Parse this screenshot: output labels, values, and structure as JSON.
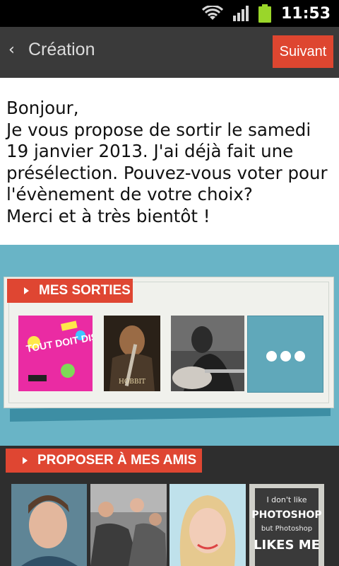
{
  "status_bar": {
    "time": "11:53",
    "icons": [
      "wifi-icon",
      "signal-icon",
      "battery-icon"
    ]
  },
  "action_bar": {
    "back_icon": "‹",
    "title": "Création",
    "next_label": "Suivant"
  },
  "message": {
    "lines": [
      "Bonjour,",
      "Je vous propose de sortir le samedi",
      "19 janvier 2013. J'ai déjà fait une",
      "présélection. Pouvez-vous voter pour",
      "l'évènement de votre choix?",
      "Merci et à très bientôt !"
    ]
  },
  "sorties": {
    "label": "MES SORTIES",
    "items": [
      {
        "name": "event-thumbnail-tout-doit-disparaitre",
        "caption": "TOUT DOIT DISPARAITRE"
      },
      {
        "name": "event-thumbnail-hobbit-poster",
        "caption": "HOBBIT"
      },
      {
        "name": "event-thumbnail-guitarist-photo",
        "caption": ""
      }
    ],
    "more_icon": "more-dots-icon"
  },
  "amis": {
    "label": "PROPOSER À MES AMIS",
    "friends": [
      {
        "name": "friend-photo-1"
      },
      {
        "name": "friend-photo-2"
      },
      {
        "name": "friend-photo-3"
      },
      {
        "name": "friend-photo-4",
        "caption_lines": [
          "I don't like",
          "PHOTOSHOP",
          "but Photoshop",
          "LIKES ME"
        ]
      }
    ]
  },
  "colors": {
    "accent": "#df4632",
    "teal": "#69b4c6",
    "actionbar": "#3a3a3a",
    "dark": "#2e2e2e"
  }
}
